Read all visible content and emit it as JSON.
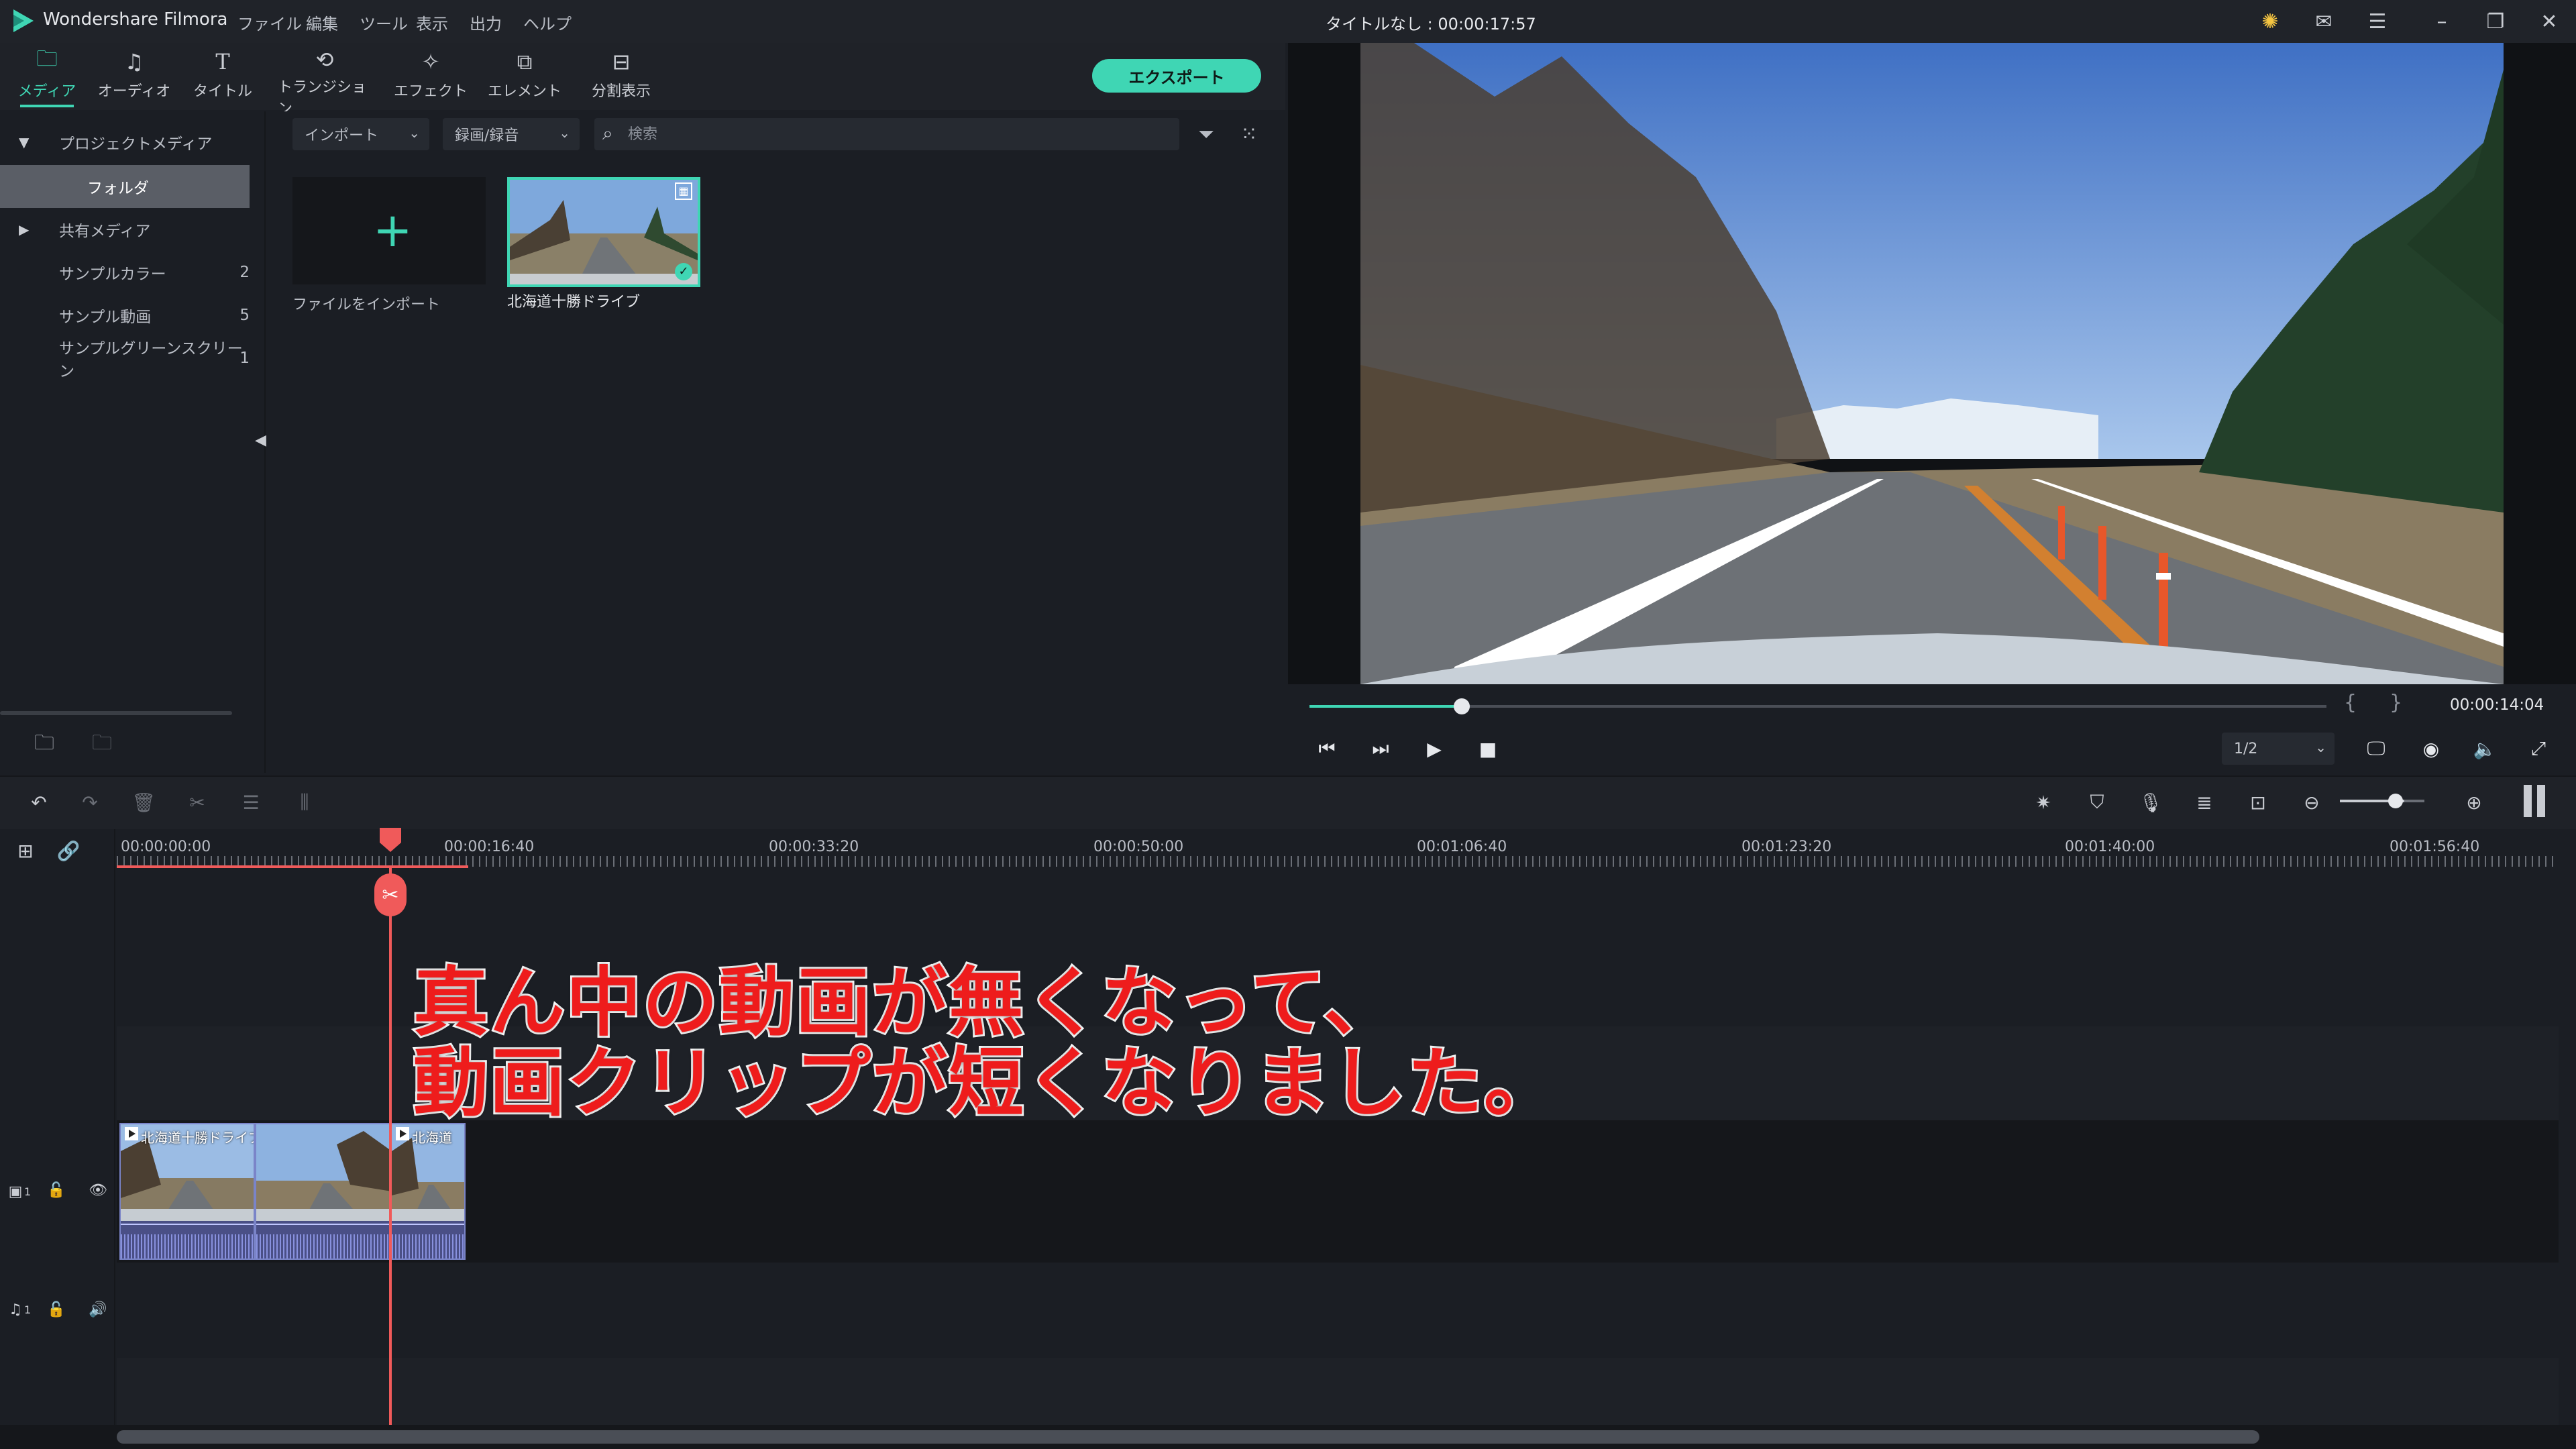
{
  "app": {
    "name": "Wondershare Filmora",
    "menu": [
      "ファイル",
      "編集",
      "ツール",
      "表示",
      "出力",
      "ヘルプ"
    ],
    "document_title": "タイトルなし : 00:00:17:57"
  },
  "tool_tabs": [
    {
      "label": "メディア",
      "icon": "folder-icon",
      "active": true
    },
    {
      "label": "オーディオ",
      "icon": "music-note-icon",
      "active": false
    },
    {
      "label": "タイトル",
      "icon": "text-t-icon",
      "active": false
    },
    {
      "label": "トランジション",
      "icon": "transition-icon",
      "active": false
    },
    {
      "label": "エフェクト",
      "icon": "effect-sparkle-icon",
      "active": false
    },
    {
      "label": "エレメント",
      "icon": "element-icon",
      "active": false
    },
    {
      "label": "分割表示",
      "icon": "split-screen-icon",
      "active": false
    }
  ],
  "export_label": "エクスポート",
  "tree": [
    {
      "label": "プロジェクトメディア",
      "arrow": "▼",
      "count": ""
    },
    {
      "label": "フォルダ",
      "arrow": "",
      "count": "",
      "selected": true
    },
    {
      "label": "共有メディア",
      "arrow": "▶",
      "count": ""
    },
    {
      "label": "サンプルカラー",
      "arrow": "",
      "count": "2"
    },
    {
      "label": "サンプル動画",
      "arrow": "",
      "count": "5"
    },
    {
      "label": "サンプルグリーンスクリーン",
      "arrow": "",
      "count": "1"
    }
  ],
  "media": {
    "import_dropdown": "インポート",
    "record_dropdown": "録画/録音",
    "search_placeholder": "検索",
    "import_tile_label": "ファイルをインポート",
    "clip_name": "北海道十勝ドライブ"
  },
  "preview": {
    "time": "00:00:14:04",
    "quality": "1/2",
    "progress": 0.15
  },
  "timeline": {
    "ruler_labels": [
      "00:00:00:00",
      "00:00:16:40",
      "00:00:33:20",
      "00:00:50:00",
      "00:01:06:40",
      "00:01:23:20",
      "00:01:40:00",
      "00:01:56:40"
    ],
    "clip_label_full": "北海道十勝ドライブ",
    "clip_label_short": "北海道",
    "video_track_label": "1",
    "audio_track_label": "1"
  },
  "overlay": {
    "line1": "真ん中の動画が無くなって、",
    "line2": "動画クリップが短くなりました。"
  },
  "colors": {
    "accent": "#3fd6b4",
    "playhead": "#f05a5a",
    "overlay_text": "#ee1c1c"
  }
}
